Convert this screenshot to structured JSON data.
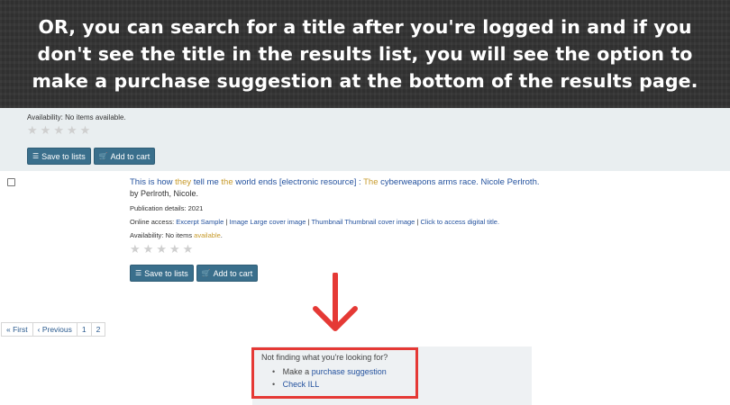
{
  "banner": {
    "text": "OR, you can search for a title after you're logged in and if you don't see the title in the results list, you will see the option to make a purchase suggestion at the bottom of the results page."
  },
  "top_record": {
    "availability_label": "Availability:",
    "availability_value": "No items",
    "availability_hl": "available",
    "availability_end": ".",
    "save_label": "Save to lists",
    "cart_label": "Add to cart"
  },
  "record": {
    "title_parts": [
      "This is how ",
      "they",
      " tell me ",
      "the",
      " world ends [electronic resource] : ",
      "The",
      " cyberweapons arms race. Nicole Perlroth."
    ],
    "author": "by Perlroth, Nicole.",
    "publication_label": "Publication details:",
    "publication_value": "2021",
    "online_label": "Online access:",
    "online_links": [
      "Excerpt Sample",
      "Image Large cover image",
      "Thumbnail Thumbnail cover image",
      "Click to access digital title."
    ],
    "availability_label": "Availability:",
    "availability_value": "No items",
    "availability_hl": "available",
    "availability_end": ".",
    "save_label": "Save to lists",
    "cart_label": "Add to cart"
  },
  "pagination": {
    "first": "« First",
    "previous": "‹ Previous",
    "pages": [
      "1",
      "2"
    ]
  },
  "suggestion": {
    "question": "Not finding what you're looking for?",
    "item1_prefix": "Make a",
    "item1_link": "purchase suggestion",
    "item2_link": "Check ILL"
  },
  "colors": {
    "banner_bg": "#333333",
    "button_bg": "#3a6f8c",
    "link": "#24529e",
    "highlight": "#c79a2a",
    "arrow_red": "#e53935"
  },
  "icons": {
    "list": "list-icon",
    "cart": "cart-icon",
    "star": "star-icon",
    "arrow": "down-arrow-icon"
  }
}
